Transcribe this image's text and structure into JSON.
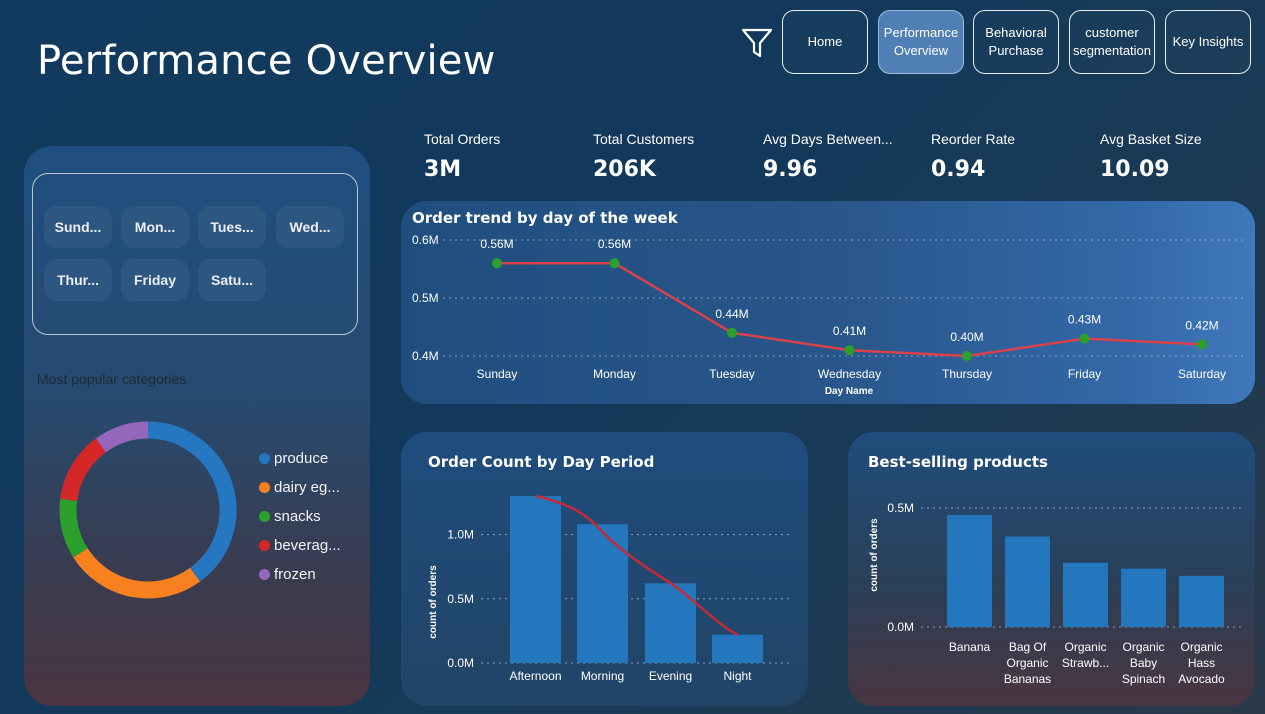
{
  "page": {
    "title": "Performance Overview"
  },
  "nav": {
    "buttons": [
      {
        "label_lines": [
          "Home"
        ],
        "active": false
      },
      {
        "label_lines": [
          "Performance",
          "Overview"
        ],
        "active": true
      },
      {
        "label_lines": [
          "Behavioral",
          "Purchase"
        ],
        "active": false
      },
      {
        "label_lines": [
          "customer",
          "segmentation"
        ],
        "active": false
      },
      {
        "label_lines": [
          "Key Insights"
        ],
        "active": false
      }
    ],
    "filter_icon": "filter-funnel-icon"
  },
  "day_slicer": {
    "items": [
      "Sund...",
      "Mon...",
      "Tues...",
      "Wed...",
      "Thur...",
      "Friday",
      "Satu..."
    ]
  },
  "categories": {
    "title": "Most popular categories",
    "legend": [
      {
        "label": "produce",
        "color": "#2677c2"
      },
      {
        "label": "dairy eg...",
        "color": "#f7811f"
      },
      {
        "label": "snacks",
        "color": "#2ca02c"
      },
      {
        "label": "beverag...",
        "color": "#d62728"
      },
      {
        "label": "frozen",
        "color": "#9467bd"
      }
    ]
  },
  "kpis": [
    {
      "label": "Total Orders",
      "value": "3M"
    },
    {
      "label": "Total Customers",
      "value": "206K"
    },
    {
      "label": "Avg Days Between...",
      "value": "9.96"
    },
    {
      "label": "Reorder Rate",
      "value": "0.94"
    },
    {
      "label": "Avg Basket Size",
      "value": "10.09"
    }
  ],
  "colors": {
    "line": "#d9414b",
    "marker": "#2ca02c",
    "bar": "#2577bd"
  },
  "chart_data": [
    {
      "type": "line",
      "title": "Order trend by day of the week",
      "xlabel": "Day Name",
      "ylabel": "",
      "categories": [
        "Sunday",
        "Monday",
        "Tuesday",
        "Wednesday",
        "Thursday",
        "Friday",
        "Saturday"
      ],
      "values": [
        0.56,
        0.56,
        0.44,
        0.41,
        0.4,
        0.43,
        0.42
      ],
      "data_labels": [
        "0.56M",
        "0.56M",
        "0.44M",
        "0.41M",
        "0.40M",
        "0.43M",
        "0.42M"
      ],
      "yticks": [
        "0.4M",
        "0.5M",
        "0.6M"
      ],
      "ylim": [
        0.4,
        0.6
      ],
      "grid": true
    },
    {
      "type": "bar",
      "title": "Order Count by Day Period",
      "xlabel": "",
      "ylabel": "count of orders",
      "categories": [
        "Afternoon",
        "Morning",
        "Evening",
        "Night"
      ],
      "values": [
        1.3,
        1.08,
        0.62,
        0.22
      ],
      "trend_line": true,
      "yticks": [
        "0.0M",
        "0.5M",
        "1.0M"
      ],
      "ylim": [
        0,
        1.3
      ],
      "grid": true
    },
    {
      "type": "bar",
      "title": "Best-selling products",
      "xlabel": "",
      "ylabel": "count of orders",
      "categories": [
        [
          "Banana"
        ],
        [
          "Bag Of",
          "Organic",
          "Bananas"
        ],
        [
          "Organic",
          "Strawb..."
        ],
        [
          "Organic",
          "Baby",
          "Spinach"
        ],
        [
          "Organic",
          "Hass",
          "Avocado"
        ]
      ],
      "values": [
        0.47,
        0.38,
        0.27,
        0.245,
        0.215
      ],
      "yticks": [
        "0.0M",
        "0.5M"
      ],
      "ylim": [
        0,
        0.5
      ],
      "grid": true
    }
  ],
  "donut_data": {
    "type": "pie",
    "values": [
      0.4,
      0.26,
      0.11,
      0.13,
      0.1
    ]
  }
}
